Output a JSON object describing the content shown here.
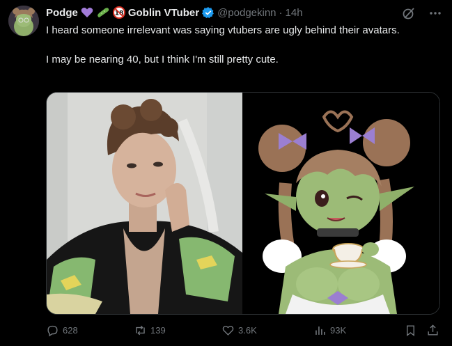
{
  "author": {
    "name": "Podge",
    "brand_label": "Goblin VTuber",
    "handle": "@podgekinn",
    "separator": "·",
    "time": "14h",
    "emojis": [
      "purple-heart",
      "cucumber",
      "no-one-under-18"
    ]
  },
  "tweet": {
    "line1": "I heard someone irrelevant was saying vtubers are ugly behind their avatars.",
    "line2": "I may be nearing 40, but I think I'm still pretty cute."
  },
  "media": {
    "left_image": "selfie photo of a person with short curly brown hair wearing a green and black knit cardigan",
    "right_image": "vtuber avatar illustration: green-skinned goblin girl with brown double buns and purple bows holding a teacup"
  },
  "actions": {
    "replies": "628",
    "reposts": "139",
    "likes": "3.6K",
    "views": "93K"
  },
  "colors": {
    "background": "#000000",
    "text": "#e7e9ea",
    "muted": "#71767b",
    "verified": "#1d9bf0",
    "border": "#2f3336"
  },
  "icons": [
    "grok-icon",
    "more-icon",
    "reply-icon",
    "repost-icon",
    "like-icon",
    "views-icon",
    "bookmark-icon",
    "share-icon"
  ]
}
